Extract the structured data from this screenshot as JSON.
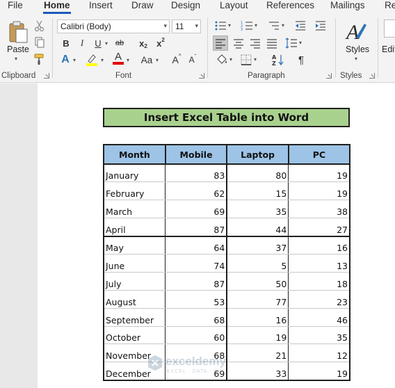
{
  "tabs": [
    "File",
    "Home",
    "Insert",
    "Draw",
    "Design",
    "Layout",
    "References",
    "Mailings",
    "Re"
  ],
  "active_tab": "Home",
  "ribbon": {
    "clipboard": {
      "paste_label": "Paste",
      "group_label": "Clipboard"
    },
    "font": {
      "font_name": "Calibri (Body)",
      "font_size": "11",
      "bold": "B",
      "italic": "I",
      "underline": "U",
      "strikethrough": "ab",
      "subscript_base": "x",
      "subscript_mark": "2",
      "superscript_base": "x",
      "superscript_mark": "2",
      "text_effects": "A",
      "font_color": "A",
      "change_case": "Aa",
      "grow_font": "A",
      "shrink_font": "A",
      "group_label": "Font",
      "highlight_color": "#ffff00",
      "font_color_value": "#e00000"
    },
    "paragraph": {
      "pilcrow": "¶",
      "group_label": "Paragraph"
    },
    "styles": {
      "styles_label": "Styles",
      "group_label": "Styles"
    },
    "editing": {
      "label": "Edit"
    }
  },
  "document": {
    "title": "Insert Excel Table into Word",
    "headers": [
      "Month",
      "Mobile",
      "Laptop",
      "PC"
    ],
    "rows": [
      [
        "January",
        "83",
        "80",
        "19"
      ],
      [
        "February",
        "62",
        "15",
        "19"
      ],
      [
        "March",
        "69",
        "35",
        "38"
      ],
      [
        "April",
        "87",
        "44",
        "27"
      ],
      [
        "May",
        "64",
        "37",
        "16"
      ],
      [
        "June",
        "74",
        "5",
        "13"
      ],
      [
        "July",
        "87",
        "50",
        "18"
      ],
      [
        "August",
        "53",
        "77",
        "23"
      ],
      [
        "September",
        "68",
        "16",
        "46"
      ],
      [
        "October",
        "60",
        "19",
        "35"
      ],
      [
        "November",
        "68",
        "21",
        "12"
      ],
      [
        "December",
        "69",
        "33",
        "19"
      ]
    ],
    "title_bg": "#a9d18e",
    "header_bg": "#9dc3e6"
  },
  "watermark": {
    "name": "exceldemy",
    "tagline": "EXCEL · DATA · BI"
  }
}
